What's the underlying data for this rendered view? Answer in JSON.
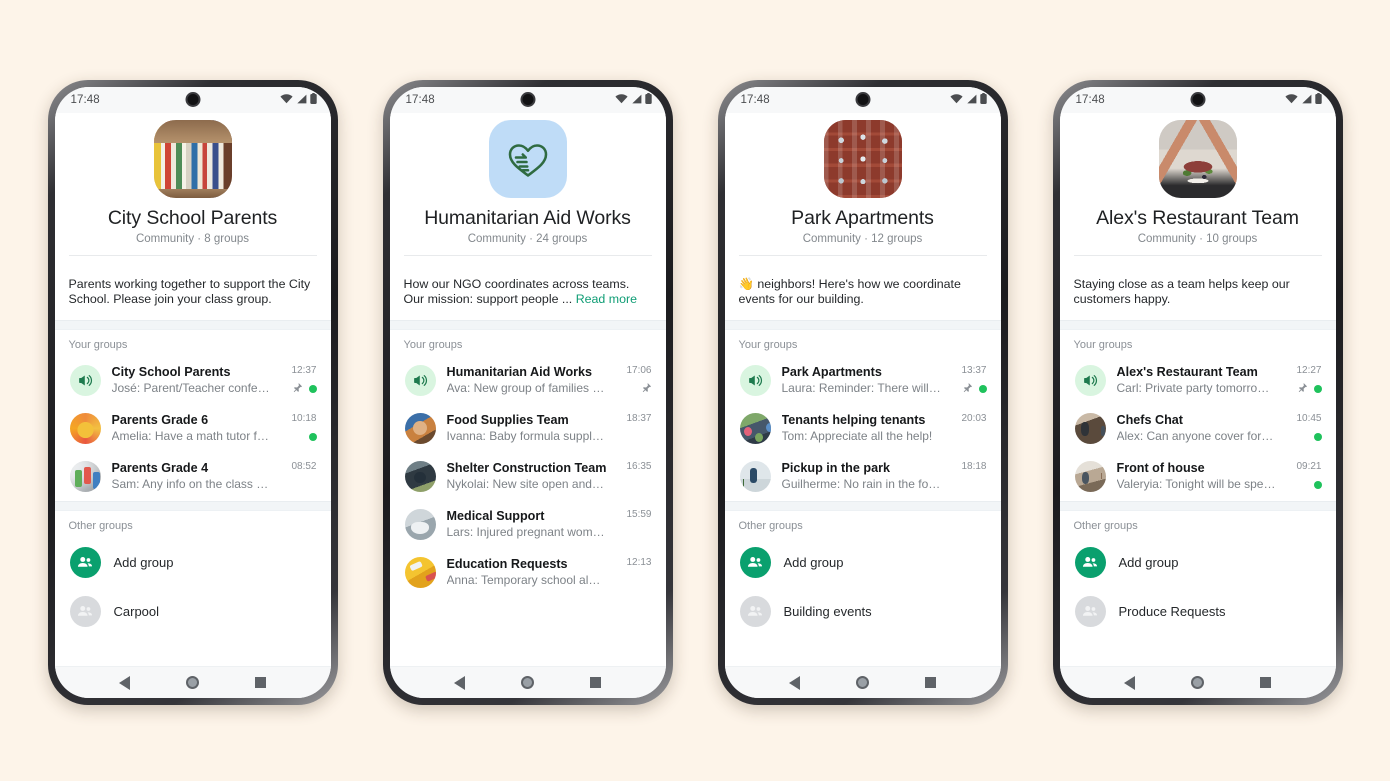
{
  "status_bar": {
    "time": "17:48",
    "icons": [
      "wifi-icon",
      "signal-icon",
      "battery-icon"
    ]
  },
  "nav_bar": {
    "back": "back-triangle-icon",
    "home": "home-circle-icon",
    "recents": "recents-square-icon"
  },
  "labels": {
    "your_groups": "Your groups",
    "other_groups": "Other groups",
    "read_more": "Read more"
  },
  "colors": {
    "page_background": "#fdf4e9",
    "accent_green": "#0aa06e",
    "link_green": "#0f9d75",
    "unread_dot": "#1fc25c",
    "announce_badge_bg": "#d9f5e0",
    "announce_badge_fg": "#1e7a4e"
  },
  "phones": [
    {
      "avatar_art": "art-books",
      "title": "City School Parents",
      "subtitle": "Community · 8 groups",
      "description": "Parents working together to support the City School. Please join your class group.",
      "has_read_more": false,
      "your_groups": [
        {
          "avatar": "announce",
          "name": "City School Parents",
          "preview": "José: Parent/Teacher conferen…",
          "time": "12:37",
          "pinned": true,
          "unread": true
        },
        {
          "avatar": "a-kids",
          "name": "Parents Grade 6",
          "preview": "Amelia: Have a math tutor for the…",
          "time": "10:18",
          "pinned": false,
          "unread": true
        },
        {
          "avatar": "a-craft",
          "name": "Parents Grade 4",
          "preview": "Sam: Any info on the class recital?",
          "time": "08:52",
          "pinned": false,
          "unread": false
        }
      ],
      "other_groups": [
        {
          "icon": "add-group-icon",
          "label": "Add group",
          "style": "add"
        },
        {
          "icon": "group-icon",
          "label": "Carpool",
          "style": "muted"
        }
      ]
    },
    {
      "avatar_art": "art-blue",
      "avatar_glyph": "heart-hand-icon",
      "title": "Humanitarian Aid Works",
      "subtitle": "Community · 24 groups",
      "description": "How our NGO coordinates across teams. Our mission: support people ... ",
      "has_read_more": true,
      "your_groups": [
        {
          "avatar": "announce",
          "name": "Humanitarian Aid Works",
          "preview": "Ava: New group of families waitin…",
          "time": "17:06",
          "pinned": true,
          "unread": false
        },
        {
          "avatar": "a-food2",
          "name": "Food Supplies Team",
          "preview": "Ivanna: Baby formula supplies running …",
          "time": "18:37",
          "pinned": false,
          "unread": false
        },
        {
          "avatar": "a-shelter",
          "name": "Shelter Construction Team",
          "preview": "Nykolai: New site open and ready for …",
          "time": "16:35",
          "pinned": false,
          "unread": false
        },
        {
          "avatar": "a-medical",
          "name": "Medical Support",
          "preview": "Lars: Injured pregnant woman in need…",
          "time": "15:59",
          "pinned": false,
          "unread": false
        },
        {
          "avatar": "a-edu",
          "name": "Education Requests",
          "preview": "Anna: Temporary school almost comp…",
          "time": "12:13",
          "pinned": false,
          "unread": false
        }
      ],
      "other_groups": []
    },
    {
      "avatar_art": "art-building",
      "title": "Park Apartments",
      "subtitle": "Community · 12 groups",
      "description": "👋 neighbors! Here's how we coordinate events for our building.",
      "has_read_more": false,
      "your_groups": [
        {
          "avatar": "announce",
          "name": "Park Apartments",
          "preview": "Laura: Reminder: There will be…",
          "time": "13:37",
          "pinned": true,
          "unread": true
        },
        {
          "avatar": "a-garden",
          "name": "Tenants helping tenants",
          "preview": "Tom: Appreciate all the help!",
          "time": "20:03",
          "pinned": false,
          "unread": false
        },
        {
          "avatar": "a-park",
          "name": "Pickup in the park",
          "preview": "Guilherme: No rain in the forecast!",
          "time": "18:18",
          "pinned": false,
          "unread": false
        }
      ],
      "other_groups": [
        {
          "icon": "add-group-icon",
          "label": "Add group",
          "style": "add"
        },
        {
          "icon": "group-icon",
          "label": "Building events",
          "style": "muted"
        }
      ]
    },
    {
      "avatar_art": "art-food",
      "title": "Alex's Restaurant Team",
      "subtitle": "Community · 10 groups",
      "description": "Staying close as a team helps keep our customers happy.",
      "has_read_more": false,
      "your_groups": [
        {
          "avatar": "announce",
          "name": "Alex's Restaurant Team",
          "preview": "Carl: Private party tomorrow in…",
          "time": "12:27",
          "pinned": true,
          "unread": true
        },
        {
          "avatar": "a-chefs",
          "name": "Chefs Chat",
          "preview": "Alex: Can anyone cover for me?",
          "time": "10:45",
          "pinned": false,
          "unread": true
        },
        {
          "avatar": "a-front",
          "name": "Front of house",
          "preview": "Valeryia: Tonight will be special!",
          "time": "09:21",
          "pinned": false,
          "unread": true
        }
      ],
      "other_groups": [
        {
          "icon": "add-group-icon",
          "label": "Add group",
          "style": "add"
        },
        {
          "icon": "group-icon",
          "label": "Produce Requests",
          "style": "muted"
        }
      ]
    }
  ]
}
